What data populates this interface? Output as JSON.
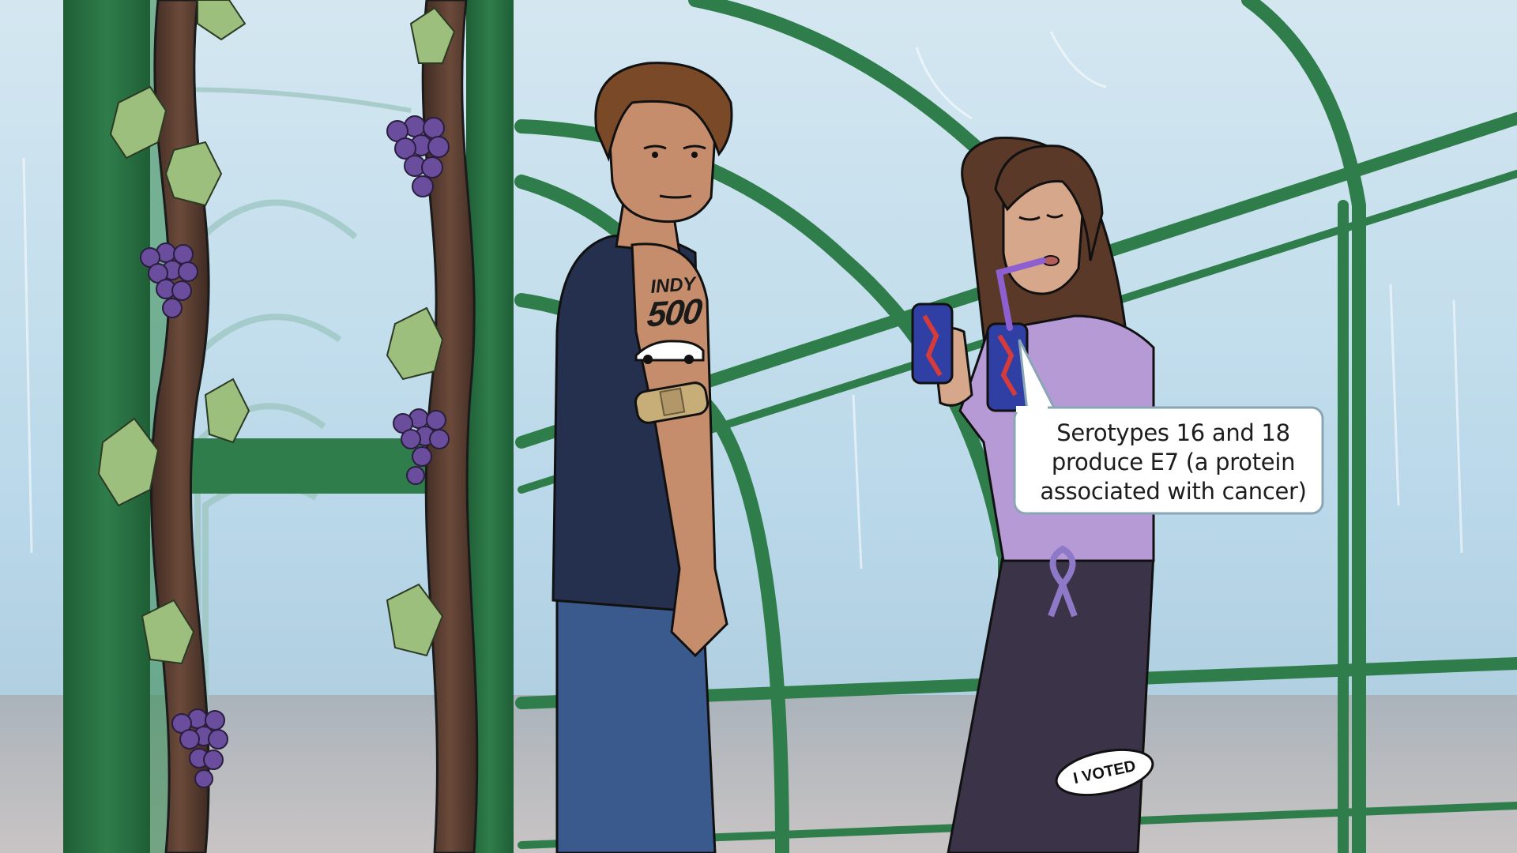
{
  "speech_bubble": {
    "line1": "Serotypes 16 and 18",
    "line2": "produce E7 (a protein",
    "line3": "associated with cancer)"
  },
  "tattoo": {
    "top": "INDY",
    "bottom": "500"
  },
  "sticker": {
    "label": "I VOTED"
  },
  "colors": {
    "frame_green": "#2f7d4a",
    "sky": "#bcd9e8",
    "shirt_navy": "#24304d",
    "shirt_lavender": "#b59ad6",
    "grapes": "#6a4d9c"
  }
}
